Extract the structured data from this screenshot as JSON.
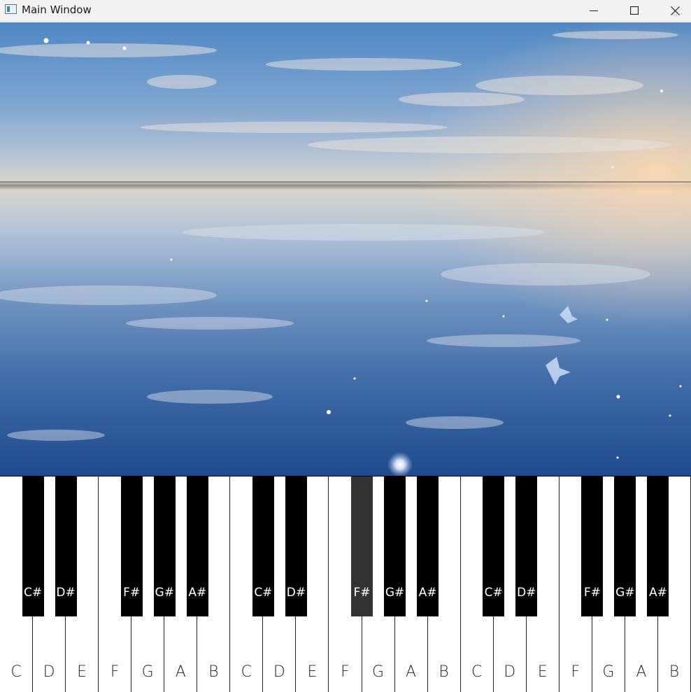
{
  "window": {
    "title": "Main Window",
    "icon": "app-window-icon",
    "controls": {
      "minimize": "minimize-icon",
      "maximize": "maximize-icon",
      "close": "close-icon"
    }
  },
  "background": {
    "description_icon": "sky-reflection-image"
  },
  "piano": {
    "white_keys": [
      "C",
      "D",
      "E",
      "F",
      "G",
      "A",
      "B",
      "C",
      "D",
      "E",
      "F",
      "G",
      "A",
      "B",
      "C",
      "D",
      "E",
      "F",
      "G",
      "A",
      "B"
    ],
    "black_keys": [
      {
        "label": "C#",
        "pressed": false
      },
      {
        "label": "D#",
        "pressed": false
      },
      {
        "label": "F#",
        "pressed": false
      },
      {
        "label": "G#",
        "pressed": false
      },
      {
        "label": "A#",
        "pressed": false
      },
      {
        "label": "C#",
        "pressed": false
      },
      {
        "label": "D#",
        "pressed": false
      },
      {
        "label": "F#",
        "pressed": true
      },
      {
        "label": "G#",
        "pressed": false
      },
      {
        "label": "A#",
        "pressed": false
      },
      {
        "label": "C#",
        "pressed": false
      },
      {
        "label": "D#",
        "pressed": false
      },
      {
        "label": "F#",
        "pressed": false
      },
      {
        "label": "G#",
        "pressed": false
      },
      {
        "label": "A#",
        "pressed": false
      }
    ],
    "colors": {
      "black_key": "#000000",
      "pressed_black_key": "#333333",
      "white_key": "#ffffff"
    }
  }
}
